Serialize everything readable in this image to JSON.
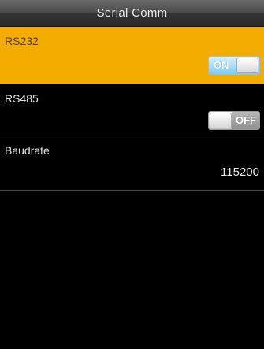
{
  "header": {
    "title": "Serial Comm"
  },
  "settings": [
    {
      "label": "RS232",
      "toggle": "ON",
      "state": true
    },
    {
      "label": "RS485",
      "toggle": "OFF",
      "state": false
    },
    {
      "label": "Baudrate",
      "value": "115200"
    }
  ],
  "colors": {
    "selected_row": "#f2ad00",
    "toggle_on": "#7ccdf7",
    "background": "#000000"
  }
}
